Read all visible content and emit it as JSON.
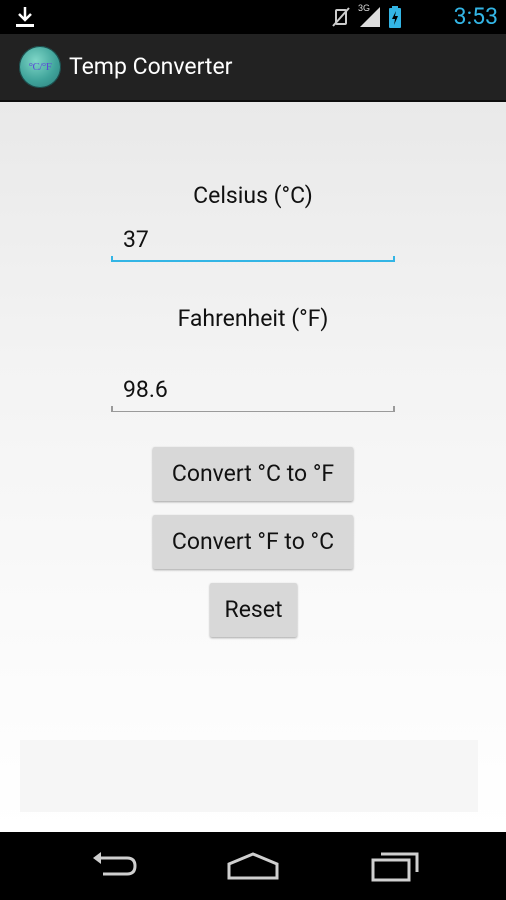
{
  "status_bar": {
    "time": "3:53",
    "network_label": "3G",
    "icons": [
      "download-icon",
      "vibrate-muted-icon",
      "signal-icon",
      "battery-charging-icon"
    ]
  },
  "action_bar": {
    "title": "Temp Converter",
    "app_icon_text": "°C/°F"
  },
  "form": {
    "celsius_label": "Celsius (°C)",
    "celsius_value": "37",
    "fahrenheit_label": "Fahrenheit (°F)",
    "fahrenheit_value": "98.6"
  },
  "buttons": {
    "c_to_f": "Convert °C to °F",
    "f_to_c": "Convert °F to °C",
    "reset": "Reset"
  },
  "nav_bar": {
    "icons": [
      "back-icon",
      "home-icon",
      "recent-apps-icon"
    ]
  },
  "colors": {
    "accent": "#33b5e5",
    "action_bar": "#222222",
    "button": "#d8d8d8"
  }
}
